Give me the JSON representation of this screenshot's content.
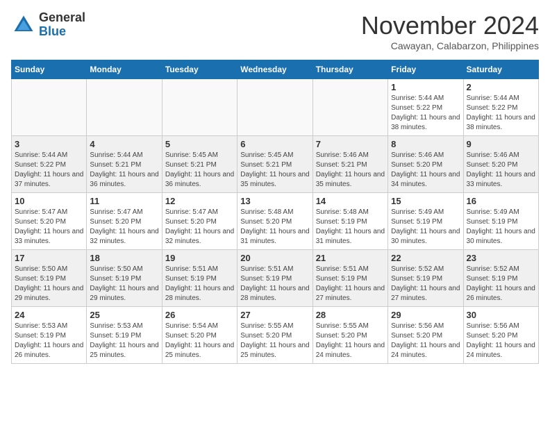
{
  "header": {
    "logo": {
      "general": "General",
      "blue": "Blue"
    },
    "title": "November 2024",
    "location": "Cawayan, Calabarzon, Philippines"
  },
  "calendar": {
    "weekdays": [
      "Sunday",
      "Monday",
      "Tuesday",
      "Wednesday",
      "Thursday",
      "Friday",
      "Saturday"
    ],
    "weeks": [
      [
        {
          "day": "",
          "info": ""
        },
        {
          "day": "",
          "info": ""
        },
        {
          "day": "",
          "info": ""
        },
        {
          "day": "",
          "info": ""
        },
        {
          "day": "",
          "info": ""
        },
        {
          "day": "1",
          "info": "Sunrise: 5:44 AM\nSunset: 5:22 PM\nDaylight: 11 hours and 38 minutes."
        },
        {
          "day": "2",
          "info": "Sunrise: 5:44 AM\nSunset: 5:22 PM\nDaylight: 11 hours and 38 minutes."
        }
      ],
      [
        {
          "day": "3",
          "info": "Sunrise: 5:44 AM\nSunset: 5:22 PM\nDaylight: 11 hours and 37 minutes."
        },
        {
          "day": "4",
          "info": "Sunrise: 5:44 AM\nSunset: 5:21 PM\nDaylight: 11 hours and 36 minutes."
        },
        {
          "day": "5",
          "info": "Sunrise: 5:45 AM\nSunset: 5:21 PM\nDaylight: 11 hours and 36 minutes."
        },
        {
          "day": "6",
          "info": "Sunrise: 5:45 AM\nSunset: 5:21 PM\nDaylight: 11 hours and 35 minutes."
        },
        {
          "day": "7",
          "info": "Sunrise: 5:46 AM\nSunset: 5:21 PM\nDaylight: 11 hours and 35 minutes."
        },
        {
          "day": "8",
          "info": "Sunrise: 5:46 AM\nSunset: 5:20 PM\nDaylight: 11 hours and 34 minutes."
        },
        {
          "day": "9",
          "info": "Sunrise: 5:46 AM\nSunset: 5:20 PM\nDaylight: 11 hours and 33 minutes."
        }
      ],
      [
        {
          "day": "10",
          "info": "Sunrise: 5:47 AM\nSunset: 5:20 PM\nDaylight: 11 hours and 33 minutes."
        },
        {
          "day": "11",
          "info": "Sunrise: 5:47 AM\nSunset: 5:20 PM\nDaylight: 11 hours and 32 minutes."
        },
        {
          "day": "12",
          "info": "Sunrise: 5:47 AM\nSunset: 5:20 PM\nDaylight: 11 hours and 32 minutes."
        },
        {
          "day": "13",
          "info": "Sunrise: 5:48 AM\nSunset: 5:20 PM\nDaylight: 11 hours and 31 minutes."
        },
        {
          "day": "14",
          "info": "Sunrise: 5:48 AM\nSunset: 5:19 PM\nDaylight: 11 hours and 31 minutes."
        },
        {
          "day": "15",
          "info": "Sunrise: 5:49 AM\nSunset: 5:19 PM\nDaylight: 11 hours and 30 minutes."
        },
        {
          "day": "16",
          "info": "Sunrise: 5:49 AM\nSunset: 5:19 PM\nDaylight: 11 hours and 30 minutes."
        }
      ],
      [
        {
          "day": "17",
          "info": "Sunrise: 5:50 AM\nSunset: 5:19 PM\nDaylight: 11 hours and 29 minutes."
        },
        {
          "day": "18",
          "info": "Sunrise: 5:50 AM\nSunset: 5:19 PM\nDaylight: 11 hours and 29 minutes."
        },
        {
          "day": "19",
          "info": "Sunrise: 5:51 AM\nSunset: 5:19 PM\nDaylight: 11 hours and 28 minutes."
        },
        {
          "day": "20",
          "info": "Sunrise: 5:51 AM\nSunset: 5:19 PM\nDaylight: 11 hours and 28 minutes."
        },
        {
          "day": "21",
          "info": "Sunrise: 5:51 AM\nSunset: 5:19 PM\nDaylight: 11 hours and 27 minutes."
        },
        {
          "day": "22",
          "info": "Sunrise: 5:52 AM\nSunset: 5:19 PM\nDaylight: 11 hours and 27 minutes."
        },
        {
          "day": "23",
          "info": "Sunrise: 5:52 AM\nSunset: 5:19 PM\nDaylight: 11 hours and 26 minutes."
        }
      ],
      [
        {
          "day": "24",
          "info": "Sunrise: 5:53 AM\nSunset: 5:19 PM\nDaylight: 11 hours and 26 minutes."
        },
        {
          "day": "25",
          "info": "Sunrise: 5:53 AM\nSunset: 5:19 PM\nDaylight: 11 hours and 25 minutes."
        },
        {
          "day": "26",
          "info": "Sunrise: 5:54 AM\nSunset: 5:20 PM\nDaylight: 11 hours and 25 minutes."
        },
        {
          "day": "27",
          "info": "Sunrise: 5:55 AM\nSunset: 5:20 PM\nDaylight: 11 hours and 25 minutes."
        },
        {
          "day": "28",
          "info": "Sunrise: 5:55 AM\nSunset: 5:20 PM\nDaylight: 11 hours and 24 minutes."
        },
        {
          "day": "29",
          "info": "Sunrise: 5:56 AM\nSunset: 5:20 PM\nDaylight: 11 hours and 24 minutes."
        },
        {
          "day": "30",
          "info": "Sunrise: 5:56 AM\nSunset: 5:20 PM\nDaylight: 11 hours and 24 minutes."
        }
      ]
    ]
  }
}
